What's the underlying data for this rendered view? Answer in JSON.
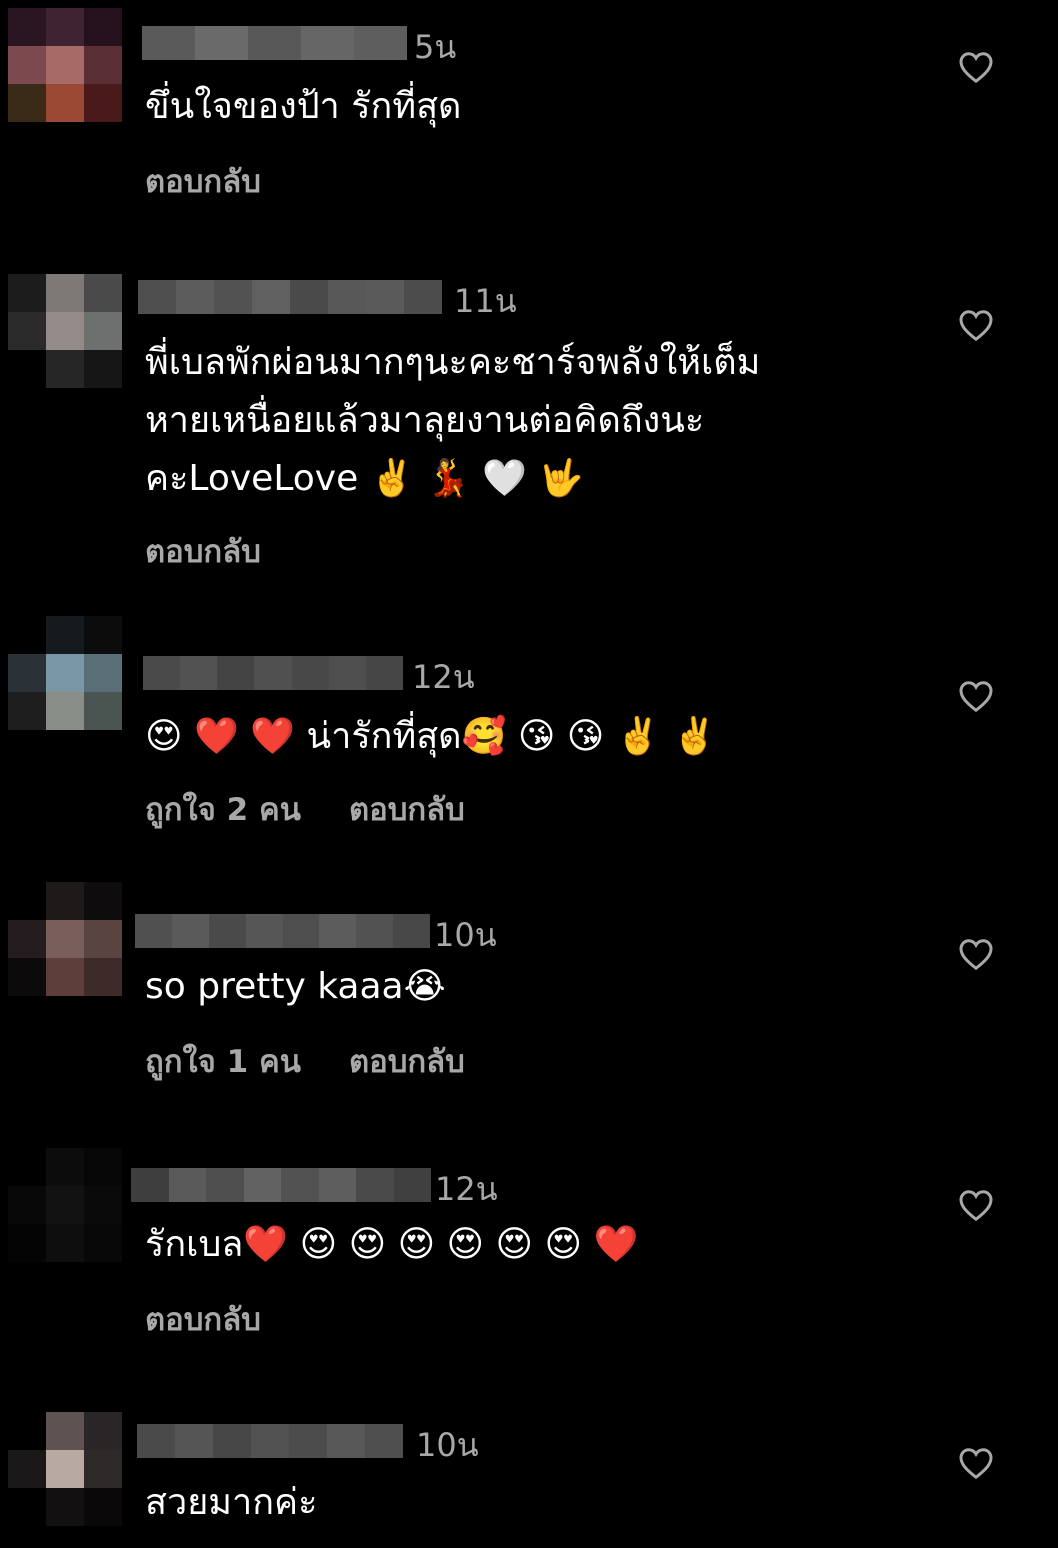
{
  "comments": [
    {
      "time": "5น",
      "text": [
        "ขึ่นใจของป้า รักที่สุด"
      ],
      "likes": "",
      "reply": "ตอบกลับ"
    },
    {
      "time": "11น",
      "text": [
        "พี่เบลพักผ่อนมากๆนะคะชาร์จพลังให้เต็ม",
        "หายเหนื่อยแล้วมาลุยงานต่อคิดถึงนะ",
        "คะLoveLove ✌️ 💃 🤍 🤟"
      ],
      "likes": "",
      "reply": "ตอบกลับ"
    },
    {
      "time": "12น",
      "text": [
        "😍 ❤️ ❤️ น่ารักที่สุด🥰 😘 😘 ✌️ ✌️"
      ],
      "likes": "ถูกใจ 2 คน",
      "reply": "ตอบกลับ"
    },
    {
      "time": "10น",
      "text": [
        "so pretty kaaa😭"
      ],
      "likes": "ถูกใจ 1 คน",
      "reply": "ตอบกลับ"
    },
    {
      "time": "12น",
      "text": [
        "รักเบล❤️ 😍 😍 😍 😍 😍 😍 ❤️"
      ],
      "likes": "",
      "reply": "ตอบกลับ"
    },
    {
      "time": "10น",
      "text": [
        "สวยมากค่ะ"
      ],
      "likes": "",
      "reply": ""
    }
  ],
  "icons": {
    "like": "heart-outline-icon"
  },
  "colors": {
    "background": "#000000",
    "text": "#ffffff",
    "muted": "#a8a8a8"
  }
}
